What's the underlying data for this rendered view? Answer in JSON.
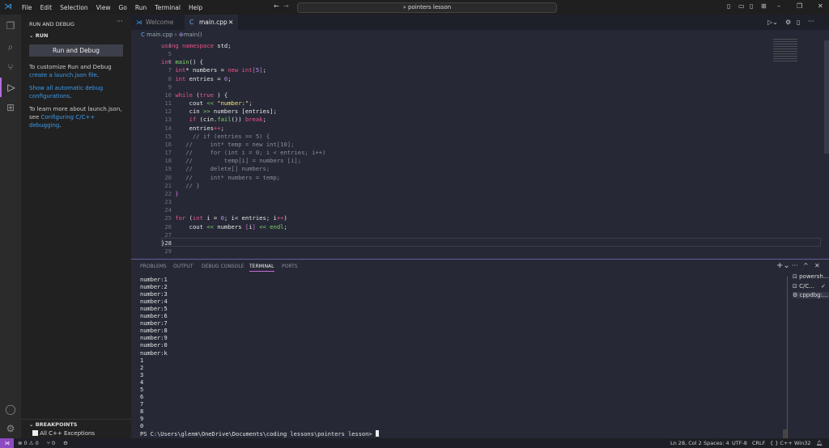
{
  "titlebar": {
    "menu": [
      "File",
      "Edit",
      "Selection",
      "View",
      "Go",
      "Run",
      "Terminal",
      "Help"
    ],
    "search": "pointers lesson"
  },
  "sidebar": {
    "title": "RUN AND DEBUG",
    "section": "RUN",
    "button": "Run and Debug",
    "text1": "To customize Run and Debug ",
    "link1": "create a launch.json file",
    "text1_end": ".",
    "link2": "Show all automatic debug configurations",
    "text2_end": ".",
    "text3": "To learn more about launch.json, see ",
    "link3": "Configuring C/C++ debugging",
    "text3_end": ".",
    "breakpoints": "BREAKPOINTS",
    "bp_item": "All C++ Exceptions"
  },
  "tabs": [
    {
      "label": "Welcome"
    },
    {
      "label": "main.cpp"
    }
  ],
  "breadcrumb": {
    "file": "main.cpp",
    "symbol": "main()"
  },
  "code": [
    {
      "n": "4",
      "t": [
        [
          "k",
          "using "
        ],
        [
          "k",
          "namespace "
        ],
        [
          "",
          "std;"
        ]
      ]
    },
    {
      "n": "5",
      "t": []
    },
    {
      "n": "6",
      "t": [
        [
          "k",
          "int "
        ],
        [
          "f",
          "main"
        ],
        [
          "",
          "() {"
        ]
      ]
    },
    {
      "n": "7",
      "t": [
        [
          "",
          "    "
        ],
        [
          "k",
          "int"
        ],
        [
          "",
          "* numbers = "
        ],
        [
          "k",
          "new "
        ],
        [
          "k",
          "int"
        ],
        [
          "b",
          "["
        ],
        [
          "n",
          "5"
        ],
        [
          "b",
          "]"
        ],
        [
          "",
          ";"
        ]
      ]
    },
    {
      "n": "8",
      "t": [
        [
          "",
          "    "
        ],
        [
          "k",
          "int "
        ],
        [
          "",
          "entries = "
        ],
        [
          "n",
          "0"
        ],
        [
          "",
          ";"
        ]
      ]
    },
    {
      "n": "9",
      "t": []
    },
    {
      "n": "10",
      "t": [
        [
          "",
          "    "
        ],
        [
          "k",
          "while "
        ],
        [
          "",
          "("
        ],
        [
          "k",
          "true"
        ],
        [
          "",
          " ) {"
        ]
      ]
    },
    {
      "n": "11",
      "t": [
        [
          "",
          "        cout "
        ],
        [
          "g",
          "<< "
        ],
        [
          "s",
          "\"number:\""
        ],
        [
          "",
          ";"
        ]
      ]
    },
    {
      "n": "12",
      "t": [
        [
          "",
          "        cin "
        ],
        [
          "g",
          ">> "
        ],
        [
          "",
          "numbers [entries];"
        ]
      ]
    },
    {
      "n": "13",
      "t": [
        [
          "",
          "        "
        ],
        [
          "k",
          "if "
        ],
        [
          "",
          "(cin."
        ],
        [
          "f",
          "fail"
        ],
        [
          "",
          "()) "
        ],
        [
          "k",
          "break"
        ],
        [
          "",
          ";"
        ]
      ]
    },
    {
      "n": "14",
      "t": [
        [
          "",
          "        entries"
        ],
        [
          "o",
          "++"
        ],
        [
          "",
          ";"
        ]
      ]
    },
    {
      "n": "15",
      "t": [
        [
          "c",
          "         // if (entries == 5) {"
        ]
      ]
    },
    {
      "n": "16",
      "t": [
        [
          "c",
          "       //     int* temp = new int[10];"
        ]
      ]
    },
    {
      "n": "17",
      "t": [
        [
          "c",
          "       //     for (int i = 0; i < entries; i++)"
        ]
      ]
    },
    {
      "n": "18",
      "t": [
        [
          "c",
          "       //         temp[i] = numbers [i];"
        ]
      ]
    },
    {
      "n": "19",
      "t": [
        [
          "c",
          "       //     delete[] numbers;"
        ]
      ]
    },
    {
      "n": "20",
      "t": [
        [
          "c",
          "       //     int* numbers = temp;"
        ]
      ]
    },
    {
      "n": "21",
      "t": [
        [
          "c",
          "       // }"
        ]
      ]
    },
    {
      "n": "22",
      "t": [
        [
          "",
          "    "
        ],
        [
          "b",
          "}"
        ]
      ]
    },
    {
      "n": "23",
      "t": []
    },
    {
      "n": "24",
      "t": []
    },
    {
      "n": "25",
      "t": [
        [
          "",
          "    "
        ],
        [
          "k",
          "for "
        ],
        [
          "",
          "("
        ],
        [
          "k",
          "int "
        ],
        [
          "",
          "i = "
        ],
        [
          "n",
          "0"
        ],
        [
          "",
          "; i< entries; i"
        ],
        [
          "o",
          "++"
        ],
        [
          "",
          ")"
        ]
      ]
    },
    {
      "n": "26",
      "t": [
        [
          "",
          "        cout "
        ],
        [
          "g",
          "<< "
        ],
        [
          "",
          "numbers "
        ],
        [
          "b",
          "["
        ],
        [
          "",
          "i"
        ],
        [
          "b",
          "]"
        ],
        [
          "",
          " "
        ],
        [
          "g",
          "<< endl"
        ],
        [
          "",
          ";"
        ]
      ]
    },
    {
      "n": "27",
      "t": []
    },
    {
      "n": "28",
      "t": [
        [
          "",
          "}"
        ]
      ]
    },
    {
      "n": "29",
      "t": []
    }
  ],
  "panel": {
    "tabs": [
      "PROBLEMS",
      "OUTPUT",
      "DEBUG CONSOLE",
      "TERMINAL",
      "PORTS"
    ],
    "terminals": [
      "powersh...",
      "C/C...",
      "cppdbg:..."
    ]
  },
  "terminal": [
    "number:1",
    "number:2",
    "number:3",
    "number:4",
    "number:5",
    "number:6",
    "number:7",
    "number:8",
    "number:9",
    "number:0",
    "number:k",
    "1",
    "2",
    "3",
    "4",
    "5",
    "6",
    "7",
    "8",
    "9",
    "0",
    "PS C:\\Users\\glenm\\OneDrive\\Documents\\coding lessons\\pointers lesson> "
  ],
  "status": {
    "errors": "0",
    "warnings": "0",
    "ports": "0",
    "position": "Ln 28, Col 2",
    "spaces": "Spaces: 4",
    "encoding": "UTF-8",
    "eol": "CRLF",
    "language": "{ } C++",
    "platform": "Win32"
  }
}
